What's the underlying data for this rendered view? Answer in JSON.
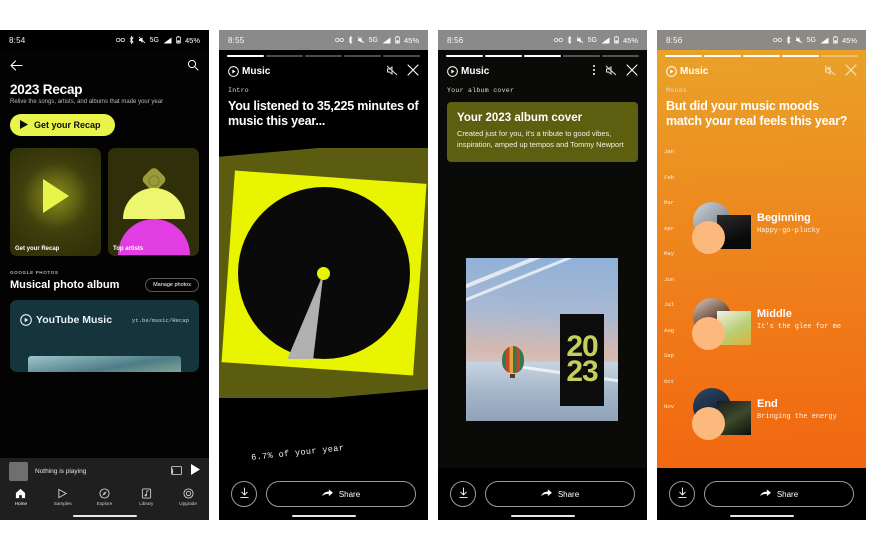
{
  "statusbar": {
    "time_1": "8:54",
    "time_2": "8:55",
    "time_3": "8:56",
    "time_4": "8:56",
    "network": "5G",
    "battery": "45%",
    "icons": [
      "glasses-icon",
      "bluetooth-icon",
      "mute-icon",
      "signal-icon",
      "battery-icon"
    ]
  },
  "panel1": {
    "back_icon": "back-arrow-icon",
    "search_icon": "search-icon",
    "title": "2023 Recap",
    "subtitle": "Relive the songs, artists, and albums that made your year",
    "cta_label": "Get your Recap",
    "cards": [
      {
        "label": "Get your Recap",
        "art": "play-button-art"
      },
      {
        "label": "Top artists",
        "art": "dome-figure-art"
      }
    ],
    "section": {
      "eyebrow": "GOOGLE PHOTOS",
      "title": "Musical photo album",
      "chip_label": "Manage photos"
    },
    "promo": {
      "brand": "YouTube Music",
      "url": "yt.be/music/Recap"
    },
    "player": {
      "text": "Nothing is playing",
      "cast_icon": "cast-icon",
      "play_icon": "play-icon"
    },
    "tabs": [
      {
        "label": "Home",
        "icon": "home-icon",
        "active": true
      },
      {
        "label": "Samples",
        "icon": "samples-icon",
        "active": false
      },
      {
        "label": "Explore",
        "icon": "explore-icon",
        "active": false
      },
      {
        "label": "Library",
        "icon": "library-icon",
        "active": false
      },
      {
        "label": "Upgrade",
        "icon": "upgrade-icon",
        "active": false
      }
    ]
  },
  "panel2": {
    "brand": "Music",
    "mute_icon": "mute-off-icon",
    "close_icon": "close-icon",
    "eyebrow": "Intro",
    "headline": "You listened to 35,225 minutes of music this year...",
    "artwork_caption": "6.7% of your year",
    "download_icon": "download-icon",
    "share_label": "Share",
    "share_icon": "share-icon",
    "progress_segments": 5,
    "progress_active": 1
  },
  "panel3": {
    "brand": "Music",
    "menu_icon": "more-vert-icon",
    "mute_icon": "mute-off-icon",
    "close_icon": "close-icon",
    "eyebrow": "Your album cover",
    "card_title": "Your 2023 album cover",
    "card_body": "Created just for you, it's a tribute to good vibes, inspiration, amped up tempos and Tommy Newport",
    "cover_year": [
      "20",
      "23"
    ],
    "download_icon": "download-icon",
    "share_label": "Share",
    "share_icon": "share-icon",
    "progress_segments": 5,
    "progress_active": 3
  },
  "panel4": {
    "brand": "Music",
    "mute_icon": "mute-off-icon",
    "close_icon": "close-icon",
    "eyebrow": "Moods",
    "headline": "But did your music moods match your real feels this year?",
    "months": [
      "Jan",
      "Feb",
      "Mar",
      "Apr",
      "May",
      "Jun",
      "Jul",
      "Aug",
      "Sep",
      "Oct",
      "Nov"
    ],
    "moods": [
      {
        "title": "Beginning",
        "subtitle": "Happy-go-plucky"
      },
      {
        "title": "Middle",
        "subtitle": "It's the glee for me"
      },
      {
        "title": "End",
        "subtitle": "Bringing the energy"
      }
    ],
    "download_icon": "download-icon",
    "share_label": "Share",
    "share_icon": "share-icon",
    "progress_segments": 5,
    "progress_active": 4
  },
  "colors": {
    "accent_yellow": "#e8f44a",
    "magenta": "#e23de2",
    "olive": "#5e5e10",
    "orange_top": "#e9a52a",
    "orange_bottom": "#f2600c",
    "teal_card": "#15343b"
  }
}
